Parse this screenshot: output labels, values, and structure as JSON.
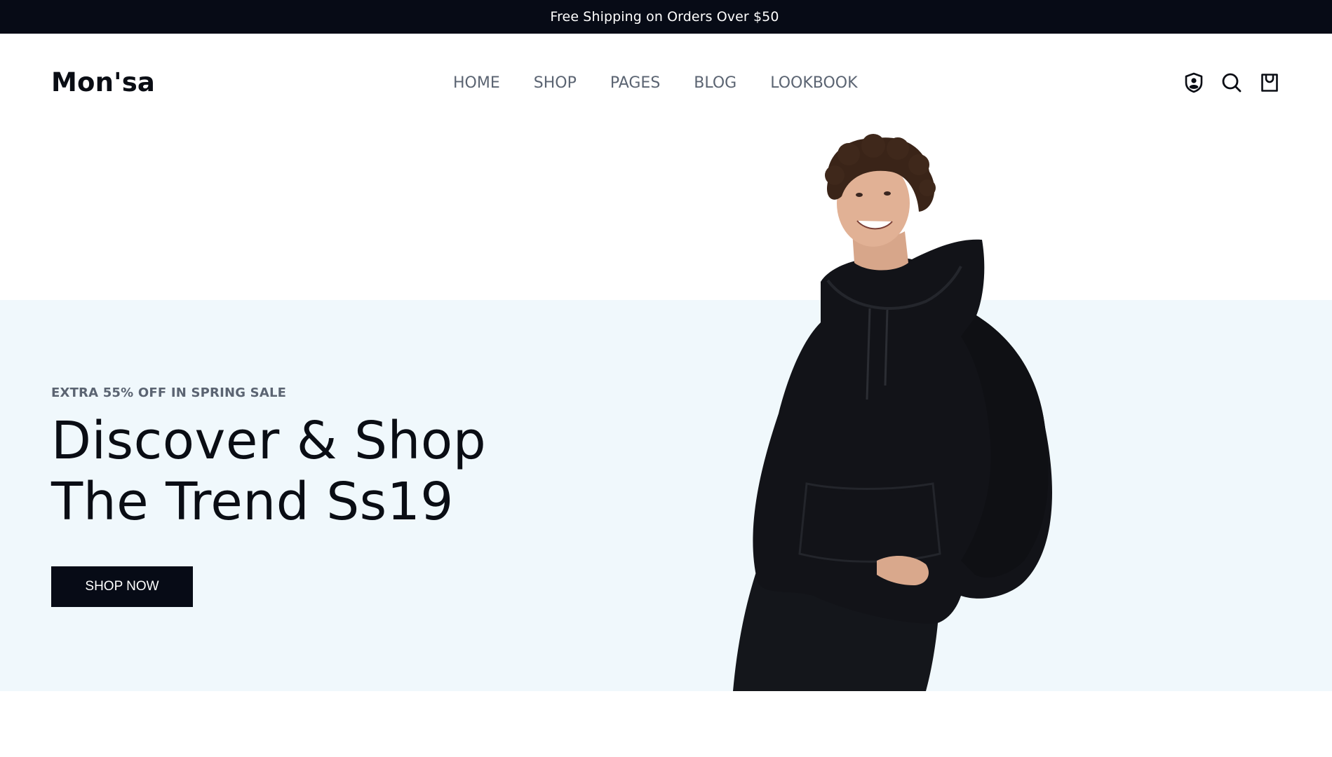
{
  "announcement": {
    "text": "Free Shipping on Orders Over $50"
  },
  "header": {
    "logo": "Mon'sa",
    "nav": [
      {
        "label": "HOME"
      },
      {
        "label": "SHOP"
      },
      {
        "label": "PAGES"
      },
      {
        "label": "BLOG"
      },
      {
        "label": "LOOKBOOK"
      }
    ],
    "icons": [
      "account-shield-icon",
      "search-icon",
      "shopping-bag-icon"
    ]
  },
  "hero": {
    "eyebrow": "EXTRA 55% OFF IN SPRING SALE",
    "headline_line1": "Discover & Shop",
    "headline_line2": "The Trend Ss19",
    "cta_label": "SHOP NOW",
    "image": "model-in-black-hoodie"
  },
  "colors": {
    "dark": "#070b16",
    "nav_text": "#5b6472",
    "hero_bg": "#f0f8fc",
    "white": "#ffffff"
  }
}
